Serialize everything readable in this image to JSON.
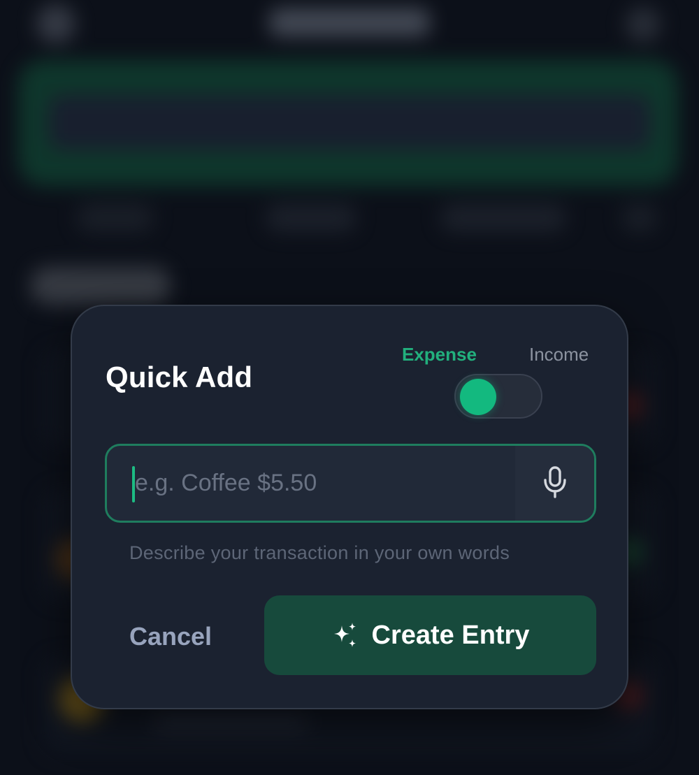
{
  "modal": {
    "title": "Quick Add",
    "type_toggle": {
      "expense_label": "Expense",
      "income_label": "Income",
      "selected": "Expense"
    },
    "input": {
      "value": "",
      "placeholder": "e.g. Coffee $5.50",
      "mic_icon": "microphone-icon"
    },
    "hint": "Describe your transaction in your own words",
    "cancel_label": "Cancel",
    "create_label": "Create Entry",
    "create_icon": "sparkle-icon"
  },
  "colors": {
    "accent": "#13b97f",
    "modal_bg": "#1b2230",
    "create_button_bg": "#174a3c",
    "input_border": "#1f7d5e",
    "cancel_text": "#98a4bd",
    "page_bg": "#0c1019"
  }
}
